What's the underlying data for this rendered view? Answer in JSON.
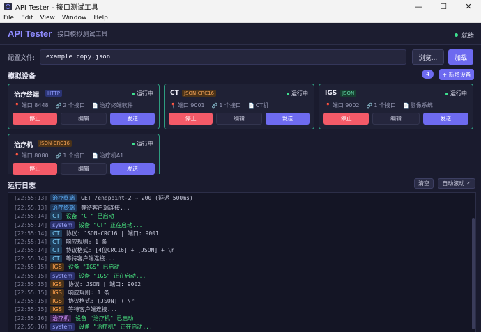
{
  "window": {
    "title": "API Tester - 接口测试工具",
    "minimize": "—",
    "maximize": "☐",
    "close": "✕"
  },
  "menu": [
    "File",
    "Edit",
    "View",
    "Window",
    "Help"
  ],
  "header": {
    "brand": "API Tester",
    "subtitle": "接口模拟测试工具",
    "status": "就绪"
  },
  "config": {
    "label": "配置文件:",
    "value": "example copy.json",
    "browse": "浏览...",
    "load": "加载"
  },
  "devices_section": {
    "title": "模拟设备",
    "count": "4",
    "add": "+ 新增设备"
  },
  "devices": [
    {
      "name": "治疗终端",
      "protocol": "HTTP",
      "status": "运行中",
      "port": "端口 8448",
      "ifaces": "2 个接口",
      "desc": "治疗终端软件",
      "stop": "停止",
      "edit": "编辑",
      "send": "发送"
    },
    {
      "name": "CT",
      "protocol": "JSON-CRC16",
      "status": "运行中",
      "port": "端口 9001",
      "ifaces": "1 个接口",
      "desc": "CT机",
      "stop": "停止",
      "edit": "编辑",
      "send": "发送"
    },
    {
      "name": "IGS",
      "protocol": "JSON",
      "status": "运行中",
      "port": "端口 9002",
      "ifaces": "1 个接口",
      "desc": "影像系统",
      "stop": "停止",
      "edit": "编辑",
      "send": "发送"
    },
    {
      "name": "治疗机",
      "protocol": "JSON-CRC16",
      "status": "运行中",
      "port": "端口 8080",
      "ifaces": "1 个接口",
      "desc": "治疗机A1",
      "stop": "停止",
      "edit": "编辑",
      "send": "发送"
    }
  ],
  "log_section": {
    "title": "运行日志",
    "clear": "清空",
    "autoscroll": "自动滚动 ✓"
  },
  "logs": [
    {
      "ts": "[22:55:13]",
      "tag": "治疗终端",
      "msg": "GET    /endpoint-2                  → 200 (延迟 500ms)"
    },
    {
      "ts": "[22:55:13]",
      "tag": "治疗终端",
      "msg": "等待客户端连接..."
    },
    {
      "ts": "[22:55:14]",
      "tag": "CT",
      "msg": "设备 \"CT\" 已启动"
    },
    {
      "ts": "[22:55:14]",
      "tag": "system",
      "msg": "设备 \"CT\" 正在启动..."
    },
    {
      "ts": "[22:55:14]",
      "tag": "CT",
      "msg": "协议: JSON-CRC16 | 端口: 9001"
    },
    {
      "ts": "[22:55:14]",
      "tag": "CT",
      "msg": "响应规则: 1 条"
    },
    {
      "ts": "[22:55:14]",
      "tag": "CT",
      "msg": "协议格式: [4位CRC16] + [JSON] + \\r"
    },
    {
      "ts": "[22:55:14]",
      "tag": "CT",
      "msg": "等待客户端连接..."
    },
    {
      "ts": "[22:55:15]",
      "tag": "IGS",
      "msg": "设备 \"IGS\" 已启动"
    },
    {
      "ts": "[22:55:15]",
      "tag": "system",
      "msg": "设备 \"IGS\" 正在启动..."
    },
    {
      "ts": "[22:55:15]",
      "tag": "IGS",
      "msg": "协议: JSON | 端口: 9002"
    },
    {
      "ts": "[22:55:15]",
      "tag": "IGS",
      "msg": "响应规则: 1 条"
    },
    {
      "ts": "[22:55:15]",
      "tag": "IGS",
      "msg": "协议格式: [JSON] + \\r"
    },
    {
      "ts": "[22:55:15]",
      "tag": "IGS",
      "msg": "等待客户端连接..."
    },
    {
      "ts": "[22:55:16]",
      "tag": "治疗机",
      "msg": "设备 \"治疗机\" 已启动"
    },
    {
      "ts": "[22:55:16]",
      "tag": "system",
      "msg": "设备 \"治疗机\" 正在启动..."
    }
  ]
}
